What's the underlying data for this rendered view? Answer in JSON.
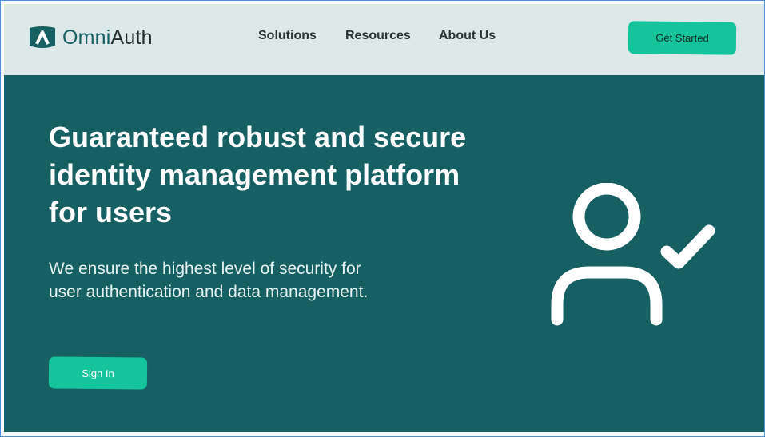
{
  "brand": {
    "name_part1": "Omni",
    "name_part2": "Auth",
    "logo_icon": "shield-a-icon"
  },
  "nav": {
    "links": [
      {
        "label": "Solutions"
      },
      {
        "label": "Resources"
      },
      {
        "label": "About Us"
      }
    ],
    "cta_label": "Get Started"
  },
  "hero": {
    "title": "Guaranteed robust and secure identity management platform for users",
    "subtitle": "We ensure the highest level of security for user authentication and data management.",
    "signin_label": "Sign In",
    "illustration_icon": "user-check-icon"
  },
  "colors": {
    "nav_bg": "#dce9e8",
    "hero_bg": "#166064",
    "accent": "#15c49a",
    "brand_dark": "#166064"
  }
}
